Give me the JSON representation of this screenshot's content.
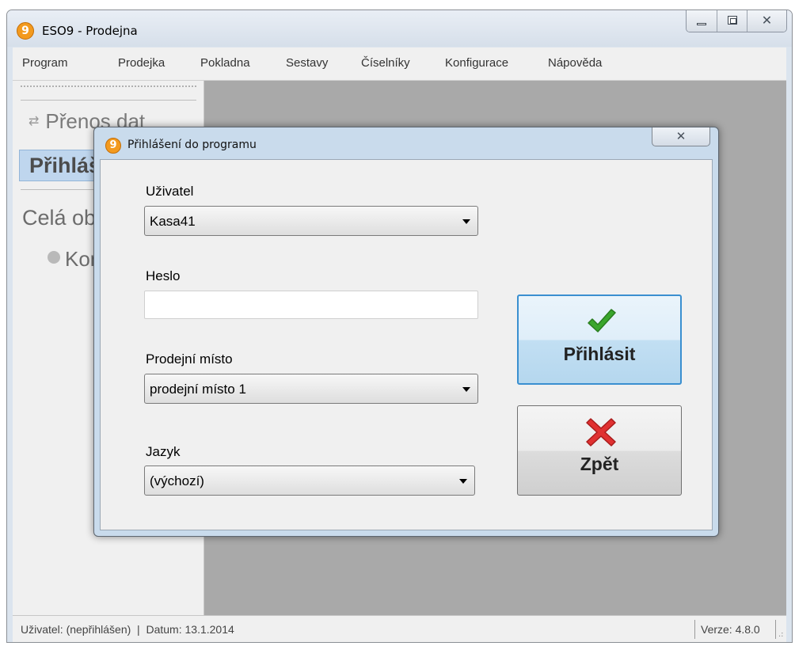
{
  "window": {
    "title": "ESO9 - Prodejna",
    "logo_char": "9"
  },
  "menu": [
    "Program",
    "Prodejka",
    "Pokladna",
    "Sestavy",
    "Číselníky",
    "Konfigurace",
    "Nápověda"
  ],
  "sidebar": {
    "items": [
      {
        "label": "Přenos dat",
        "icon": "transfer-icon"
      },
      {
        "label": "Přihlášení",
        "icon": "user-icon",
        "selected": true
      }
    ],
    "group": "Celá obrazovka",
    "subitems": [
      {
        "label": "Konec",
        "icon": "close-circle-icon"
      }
    ]
  },
  "dialog": {
    "title": "Přihlášení do programu",
    "logo_char": "9",
    "user": {
      "label": "Uživatel",
      "value": "Kasa41"
    },
    "password": {
      "label": "Heslo",
      "value": ""
    },
    "store": {
      "label": "Prodejní místo",
      "value": "prodejní místo 1"
    },
    "language": {
      "label": "Jazyk",
      "value": "(výchozí)"
    },
    "login_button": {
      "label": "Přihlásit",
      "icon": "check-icon"
    },
    "back_button": {
      "label": "Zpět",
      "icon": "cross-icon"
    }
  },
  "status": {
    "user_date": "Uživatel: (nepřihlášen)  |  Datum: 13.1.2014",
    "version": "Verze: 4.8.0"
  },
  "colors": {
    "accent": "#f39a1e",
    "selection": "#bfd6ee",
    "check": "#3aa62c",
    "cross": "#e03131"
  }
}
